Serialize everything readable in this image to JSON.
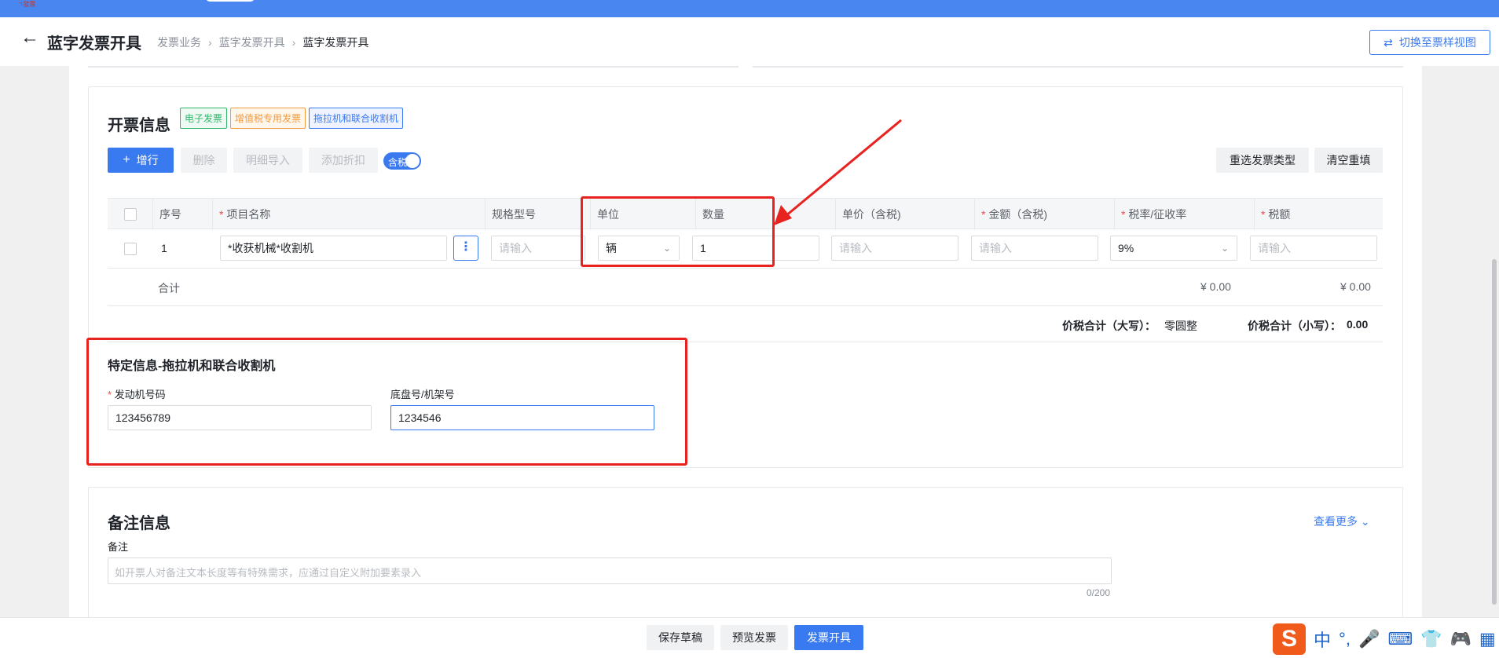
{
  "header": {
    "logo_text": "ㄱ發票",
    "title": "蓝字发票开具",
    "breadcrumb": [
      "发票业务",
      "蓝字发票开具",
      "蓝字发票开具"
    ],
    "switch_label": "切换至票样视图"
  },
  "invoice": {
    "title": "开票信息",
    "tags": [
      "电子发票",
      "增值税专用发票",
      "拖拉机和联合收割机"
    ],
    "buttons": {
      "add": "增行",
      "delete": "删除",
      "import": "明细导入",
      "discount": "添加折扣",
      "reselect": "重选发票类型",
      "clear": "清空重填"
    },
    "tax_toggle": {
      "label": "含税",
      "on": true
    },
    "columns": [
      "序号",
      "项目名称",
      "规格型号",
      "单位",
      "数量",
      "单价（含税)",
      "金额（含税)",
      "税率/征收率",
      "税额"
    ],
    "required_columns": [
      "项目名称",
      "金额（含税)",
      "税率/征收率",
      "税额"
    ],
    "rows": [
      {
        "index": "1",
        "item_name": "*收获机械*收割机",
        "spec_placeholder": "请输入",
        "unit": "辆",
        "quantity": "1",
        "price_placeholder": "请输入",
        "amount_placeholder": "请输入",
        "tax_rate": "9%",
        "tax_placeholder": "请输入"
      }
    ],
    "sum_label": "合计",
    "sum_amount": "¥ 0.00",
    "sum_tax": "¥ 0.00",
    "total_upper_label": "价税合计（大写）：",
    "total_upper_value": "零圆整",
    "total_lower_label": "价税合计（小写）：",
    "total_lower_value": "0.00"
  },
  "special": {
    "title": "特定信息-拖拉机和联合收割机",
    "engine_label": "发动机号码",
    "engine_value": "123456789",
    "chassis_label": "底盘号/机架号",
    "chassis_value": "1234546"
  },
  "remarks": {
    "title": "备注信息",
    "more": "查看更多",
    "label": "备注",
    "placeholder": "如开票人对备注文本长度等有特殊需求，应通过自定义附加要素录入",
    "counter": "0/200"
  },
  "footer": {
    "save_draft": "保存草稿",
    "preview": "预览发票",
    "issue": "发票开具"
  },
  "ime": {
    "logo": "S",
    "lang": "中",
    "punct": "°,"
  },
  "colors": {
    "primary": "#3a7af0",
    "topbar": "#4a86f0",
    "annotation": "#e8231f",
    "required": "#f04848"
  }
}
